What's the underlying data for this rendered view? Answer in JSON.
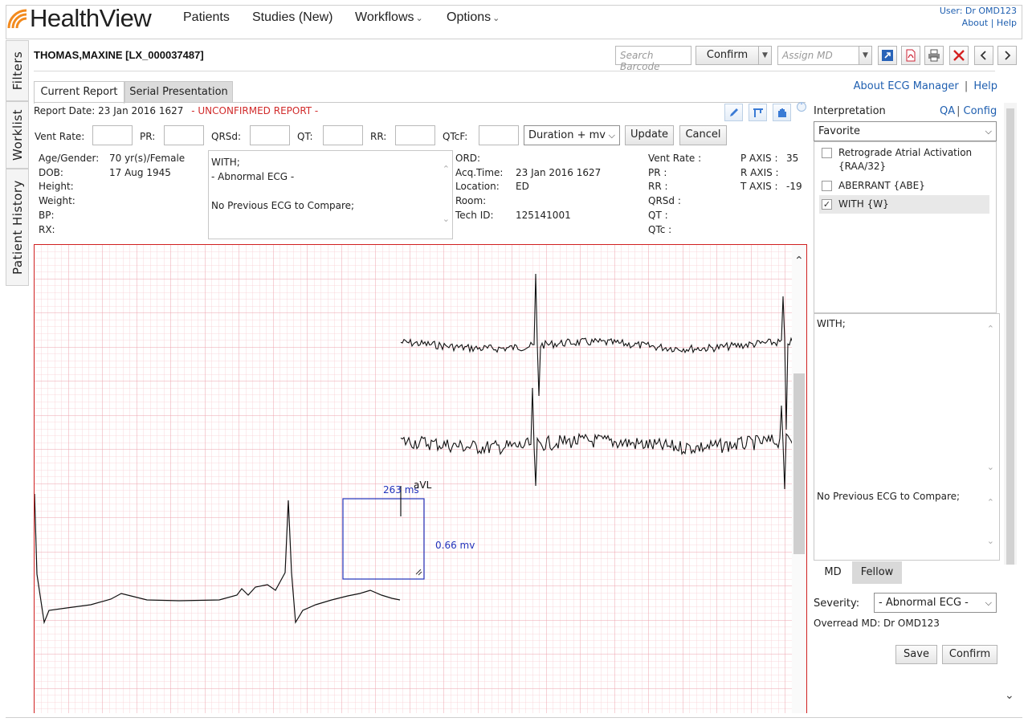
{
  "app": {
    "name": "HealthView"
  },
  "nav": {
    "items": [
      {
        "label": "Patients"
      },
      {
        "label": "Studies (New)"
      },
      {
        "label": "Workflows"
      },
      {
        "label": "Options"
      }
    ]
  },
  "user": {
    "label": "User: Dr OMD123",
    "about": "About",
    "separator": "|",
    "help": "Help"
  },
  "sidebar": {
    "tabs": [
      {
        "label": "Filters"
      },
      {
        "label": "Worklist"
      },
      {
        "label": "Patient History"
      }
    ]
  },
  "patient": {
    "name": "THOMAS,MAXINE [LX_000037487]"
  },
  "toolbar": {
    "barcode_placeholder": "Search Barcode",
    "confirm_label": "Confirm",
    "assign_placeholder": "Assign MD"
  },
  "tabs": {
    "current": "Current Report",
    "serial": "Serial Presentation"
  },
  "links": {
    "ecg_manager": "About ECG Manager",
    "separator": "|",
    "help": "Help"
  },
  "report": {
    "date_label": "Report Date: 23 Jan 2016 1627",
    "status": "- UNCONFIRMED REPORT -"
  },
  "measurements": {
    "vent_rate": "Vent Rate:",
    "pr": "PR:",
    "qrsd": "QRSd:",
    "qt": "QT:",
    "rr": "RR:",
    "qtcf": "QTcF:",
    "mode": "Duration + mv",
    "update": "Update",
    "cancel": "Cancel"
  },
  "demographics": {
    "age_gender_label": "Age/Gender:",
    "age_gender_value": "70 yr(s)/Female",
    "dob_label": "DOB:",
    "dob_value": "17 Aug 1945",
    "height_label": "Height:",
    "weight_label": "Weight:",
    "bp_label": "BP:",
    "rx_label": "RX:"
  },
  "comment": {
    "line1": "WITH;",
    "line2": "- Abnormal ECG -",
    "line3": "No Previous ECG to Compare;"
  },
  "order": {
    "ord_label": "ORD:",
    "acq_label": "Acq.Time:",
    "acq_value": "23 Jan 2016 1627",
    "location_label": "Location:",
    "location_value": "ED",
    "room_label": "Room:",
    "tech_label": "Tech ID:",
    "tech_value": "125141001"
  },
  "intervals": {
    "vent_rate": "Vent Rate :",
    "pr": "PR :",
    "rr": "RR :",
    "qrsd": "QRSd :",
    "qt": "QT :",
    "qtc": "QTc :",
    "p_axis_label": "P AXIS :",
    "p_axis_value": "35",
    "r_axis_label": "R AXIS :",
    "t_axis_label": "T AXIS :",
    "t_axis_value": "-19"
  },
  "ecg": {
    "caliper_ms": "263 ms",
    "caliper_mv": "0.66 mv",
    "lead_label": "aVL"
  },
  "interpretation": {
    "title": "Interpretation",
    "qa": "QA",
    "separator": "|",
    "config": "Config",
    "favorite": "Favorite",
    "items": [
      {
        "label": "Retrograde Atrial Activation {RAA/32}",
        "checked": false
      },
      {
        "label": "ABERRANT {ABE}",
        "checked": false
      },
      {
        "label": "WITH {W}",
        "checked": true
      }
    ],
    "statement1": "WITH;",
    "statement2": "No Previous ECG to Compare;"
  },
  "md_tabs": {
    "md": "MD",
    "fellow": "Fellow"
  },
  "severity": {
    "label": "Severity:",
    "value": "- Abnormal ECG -"
  },
  "overread": {
    "label": "Overread MD: Dr OMD123"
  },
  "actions": {
    "save": "Save",
    "confirm": "Confirm"
  },
  "colors": {
    "link": "#1f5fb0",
    "warning": "#d12b2b",
    "grid_minor": "#f6c8cf",
    "grid_major": "#eb97a4",
    "caliper": "#1f2fbf",
    "logo_orange": "#f28a1e"
  }
}
